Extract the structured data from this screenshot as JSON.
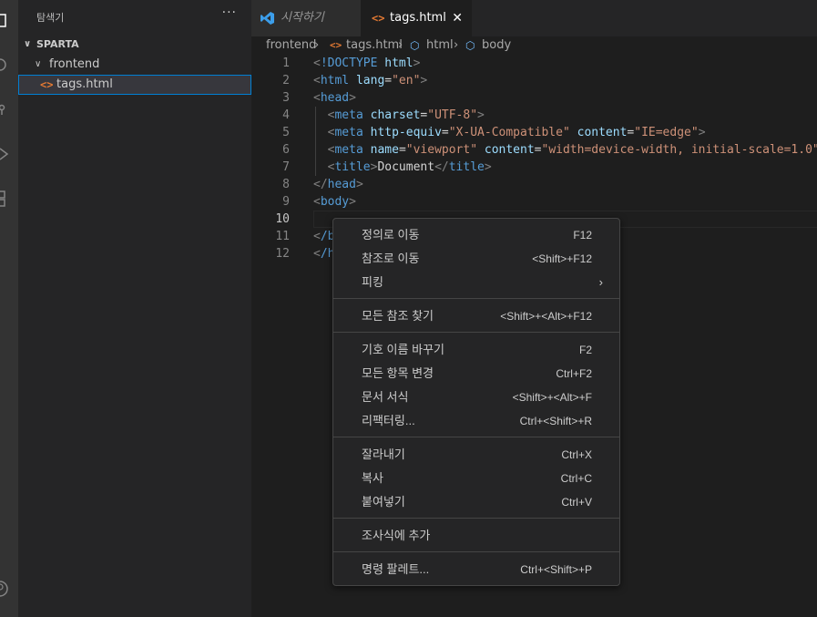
{
  "activity": {
    "icons": [
      "explorer-icon",
      "search-icon",
      "source-control-icon",
      "run-debug-icon",
      "extensions-icon",
      "account-icon"
    ]
  },
  "sidebar": {
    "title": "탐색기",
    "more": "···",
    "root": "SPARTA",
    "folder": "frontend",
    "file": "tags.html"
  },
  "tabs": [
    {
      "label": "시작하기",
      "active": false
    },
    {
      "label": "tags.html",
      "active": true,
      "close": "✕"
    }
  ],
  "breadcrumb": {
    "folder": "frontend",
    "file": "tags.html",
    "html": "html",
    "body": "body"
  },
  "editor": {
    "line_numbers": [
      "1",
      "2",
      "3",
      "4",
      "5",
      "6",
      "7",
      "8",
      "9",
      "10",
      "11",
      "12"
    ],
    "line4": {
      "tag": "meta",
      "attr": "charset",
      "val": "\"UTF-8\""
    },
    "line5": {
      "tag": "meta",
      "attr1": "http-equiv",
      "val1": "\"X-UA-Compatible\"",
      "attr2": "content",
      "val2": "\"IE=edge\""
    },
    "line6": {
      "tag": "meta",
      "attr1": "name",
      "val1": "\"viewport\"",
      "attr2": "content",
      "val2": "\"width=device-width, initial-scale=1.0\""
    },
    "line7_title": "title",
    "line7_text": "Document",
    "doctype": "!DOCTYPE",
    "html_kw": "html",
    "lang_attr": "lang",
    "lang_val": "\"en\"",
    "head": "head",
    "body": "body",
    "line11_frag": "/b",
    "line12_frag": "/h"
  },
  "context_menu": {
    "items": [
      {
        "label": "정의로 이동",
        "key": "F12"
      },
      {
        "label": "참조로 이동",
        "key": "<Shift>+F12"
      },
      {
        "label": "피킹",
        "key": "",
        "submenu": "›"
      },
      {
        "label": "모든 참조 찾기",
        "key": "<Shift>+<Alt>+F12"
      },
      {
        "label": "기호 이름 바꾸기",
        "key": "F2"
      },
      {
        "label": "모든 항목 변경",
        "key": "Ctrl+F2"
      },
      {
        "label": "문서 서식",
        "key": "<Shift>+<Alt>+F"
      },
      {
        "label": "리팩터링...",
        "key": "Ctrl+<Shift>+R"
      },
      {
        "label": "잘라내기",
        "key": "Ctrl+X"
      },
      {
        "label": "복사",
        "key": "Ctrl+C"
      },
      {
        "label": "붙여넣기",
        "key": "Ctrl+V"
      },
      {
        "label": "조사식에 추가",
        "key": ""
      },
      {
        "label": "명령 팔레트...",
        "key": "Ctrl+<Shift>+P"
      }
    ]
  }
}
